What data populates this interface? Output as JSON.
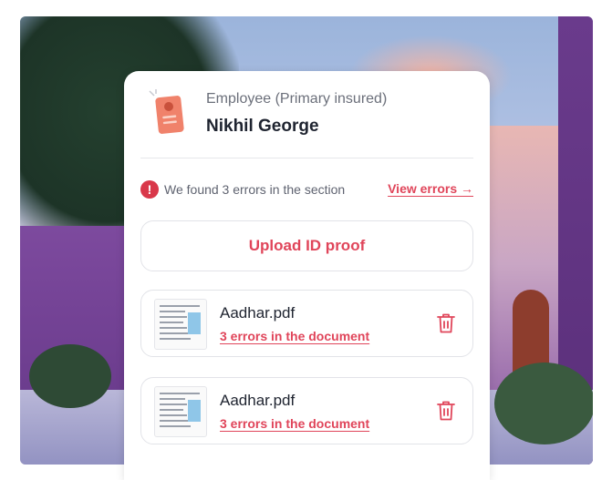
{
  "colors": {
    "accent": "#e0455a",
    "error_icon": "#d9384a",
    "text_primary": "#1f2430",
    "text_secondary": "#6b6f7a"
  },
  "header": {
    "icon": "id-document-icon",
    "role": "Employee (Primary insured)",
    "name": "Nikhil George"
  },
  "errors_banner": {
    "icon": "error-exclamation-icon",
    "icon_glyph": "!",
    "message": "We found 3 errors in the section",
    "link_label": "View errors →"
  },
  "upload": {
    "label": "Upload ID proof"
  },
  "files": [
    {
      "name": "Aadhar.pdf",
      "error_link": "3 errors in the document",
      "delete_icon": "trash-icon"
    },
    {
      "name": "Aadhar.pdf",
      "error_link": "3 errors in the document",
      "delete_icon": "trash-icon"
    }
  ]
}
